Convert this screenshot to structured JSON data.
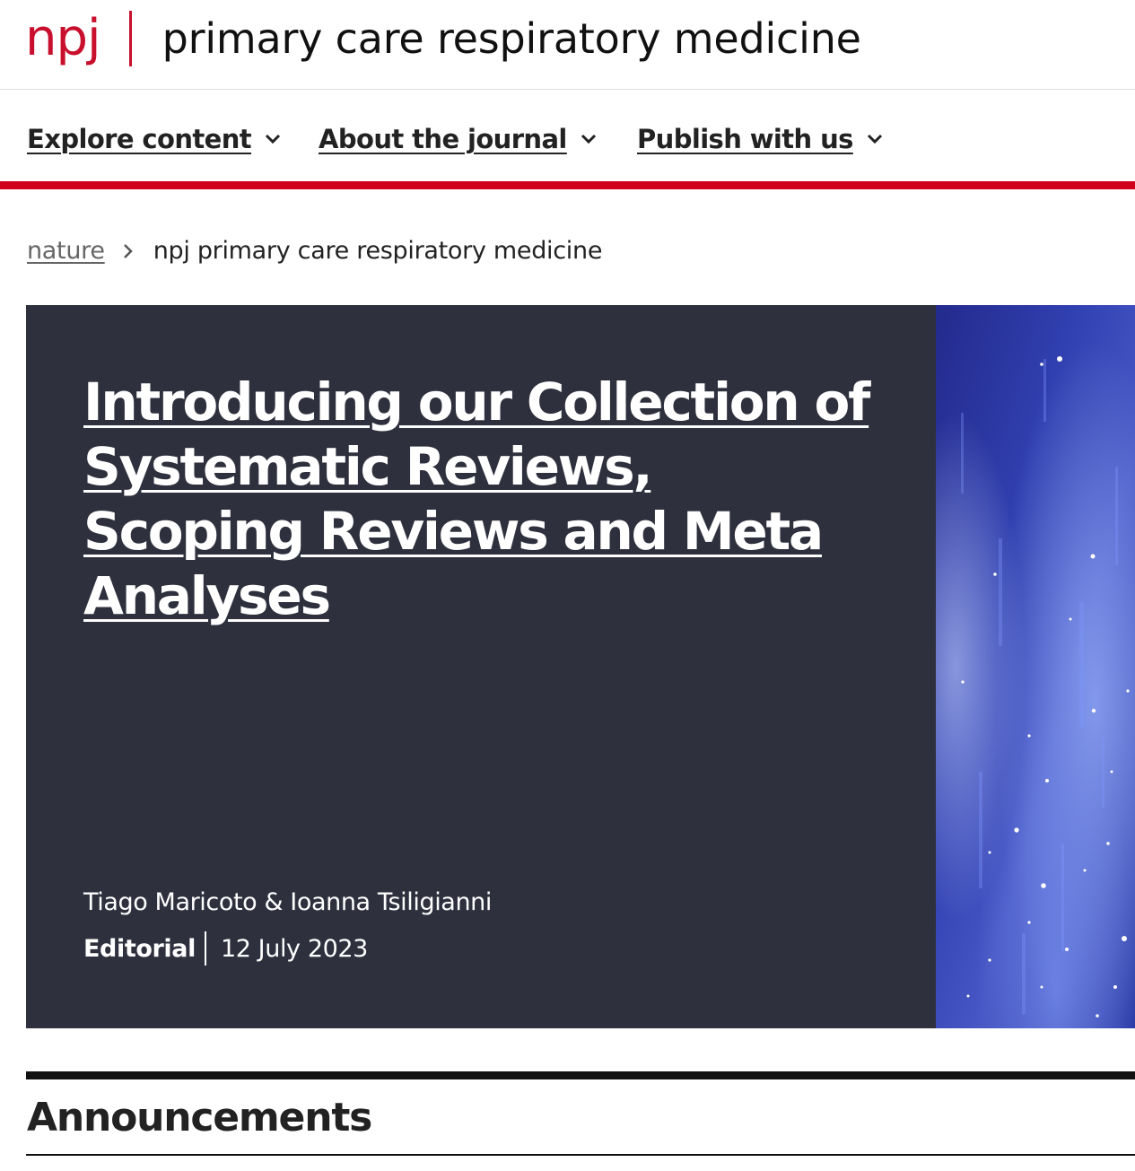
{
  "header": {
    "brand_short": "npj",
    "journal_title": "primary care respiratory medicine",
    "brand_color": "#c8102e"
  },
  "nav": {
    "items": [
      {
        "label": "Explore content",
        "icon": "chevron-down-icon"
      },
      {
        "label": "About the journal",
        "icon": "chevron-down-icon"
      },
      {
        "label": "Publish with us",
        "icon": "chevron-down-icon"
      }
    ],
    "accent_color": "#d0021b"
  },
  "breadcrumb": {
    "root": "nature",
    "separator_icon": "chevron-right-icon",
    "current": "npj primary care respiratory medicine"
  },
  "hero": {
    "title": "Introducing our Collection of Systematic Reviews, Scoping Reviews and Meta Analyses",
    "authors": "Tiago Maricoto & Ioanna Tsiligianni",
    "article_type": "Editorial",
    "date": "12 July 2023",
    "background_color": "#2e303d",
    "image_description_icon": "starry-blue-cover-image"
  },
  "announcements": {
    "heading": "Announcements"
  }
}
